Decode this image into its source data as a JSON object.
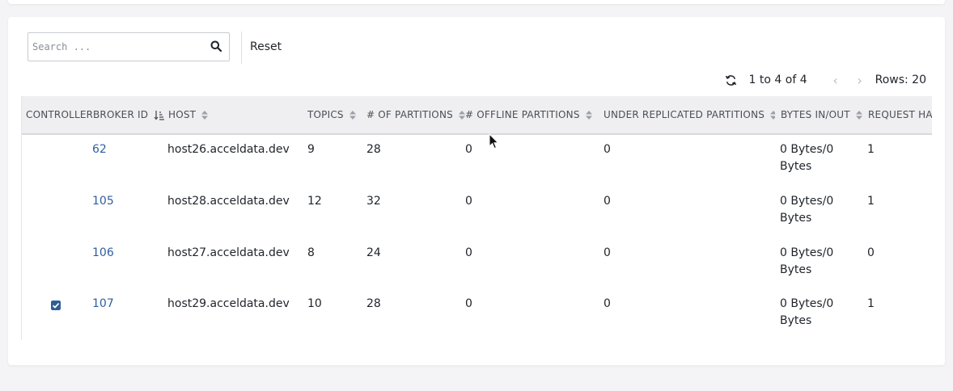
{
  "search": {
    "placeholder": "Search ..."
  },
  "toolbar": {
    "reset_label": "Reset"
  },
  "pager": {
    "range": "1 to 4 of 4",
    "prev": "‹",
    "next": "›",
    "rows": "Rows: 20"
  },
  "table": {
    "headers": {
      "controller": "CONTROLLER",
      "broker_id": "BROKER ID",
      "host": "HOST",
      "topics": "TOPICS",
      "partitions": "# OF PARTITIONS",
      "offline": "# OFFLINE PARTITIONS",
      "under_replicated": "UNDER REPLICATED PARTITIONS",
      "bytes": "BYTES IN/OUT",
      "request": "REQUEST HANDLER IDLE RATIO"
    },
    "rows": [
      {
        "controller": false,
        "broker_id": "62",
        "host": "host26.acceldata.dev",
        "topics": "9",
        "partitions": "28",
        "offline": "0",
        "under_replicated": "0",
        "bytes": "0 Bytes/0 Bytes",
        "request": "1"
      },
      {
        "controller": false,
        "broker_id": "105",
        "host": "host28.acceldata.dev",
        "topics": "12",
        "partitions": "32",
        "offline": "0",
        "under_replicated": "0",
        "bytes": "0 Bytes/0 Bytes",
        "request": "1"
      },
      {
        "controller": false,
        "broker_id": "106",
        "host": "host27.acceldata.dev",
        "topics": "8",
        "partitions": "24",
        "offline": "0",
        "under_replicated": "0",
        "bytes": "0 Bytes/0 Bytes",
        "request": "0"
      },
      {
        "controller": true,
        "broker_id": "107",
        "host": "host29.acceldata.dev",
        "topics": "10",
        "partitions": "28",
        "offline": "0",
        "under_replicated": "0",
        "bytes": "0 Bytes/0 Bytes",
        "request": "1"
      }
    ]
  },
  "colors": {
    "link": "#2f5fa0",
    "checkbox": "#2d5f93",
    "header_bg": "#efeff1"
  }
}
